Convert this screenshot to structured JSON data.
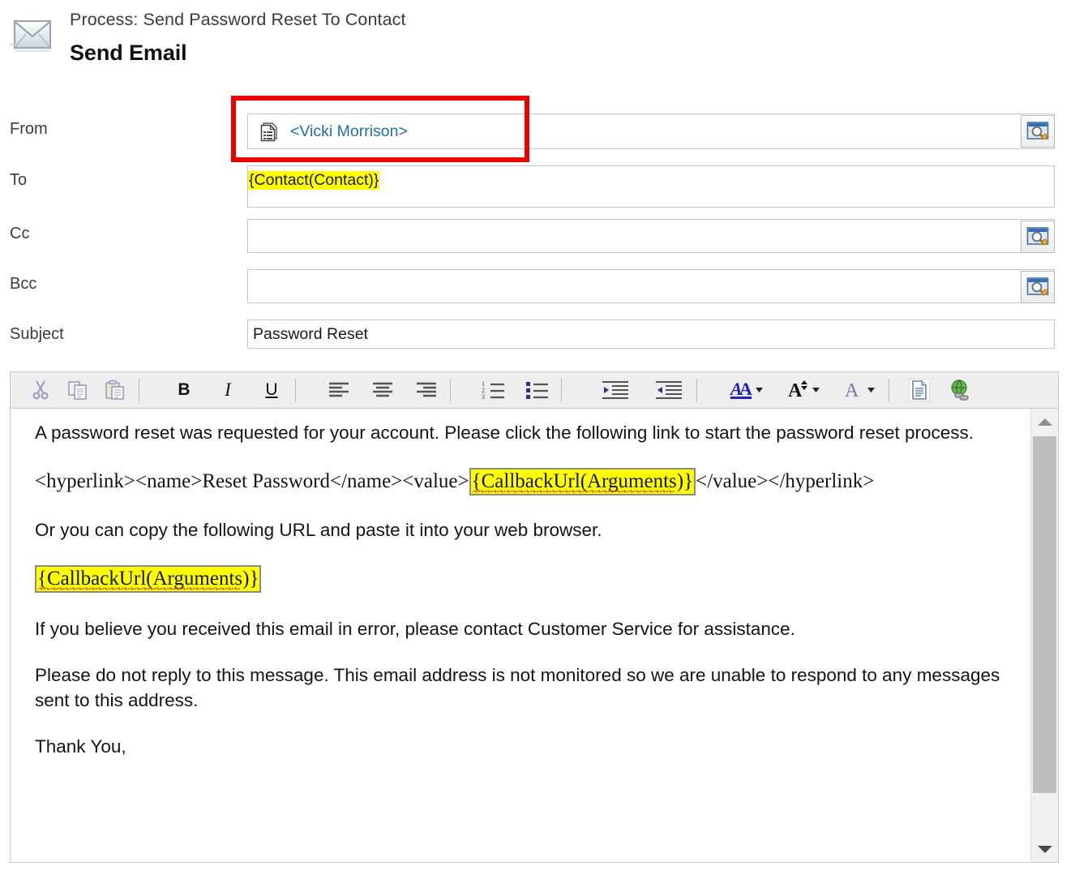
{
  "header": {
    "process_label": "Process: Send Password Reset To Contact",
    "title": "Send Email",
    "icon": "envelope-icon"
  },
  "form": {
    "fields": [
      {
        "label": "From",
        "value": "<Vicki Morrison>",
        "style": "link",
        "icon": "record-lookup-icon",
        "has_lookup_button": true,
        "lookup_icon": "lookup-window-search-icon",
        "highlighted_annotation": true
      },
      {
        "label": "To",
        "value": "{Contact(Contact)}",
        "style": "token-highlight",
        "has_lookup_button": false
      },
      {
        "label": "Cc",
        "value": "",
        "style": "plain",
        "has_lookup_button": true,
        "lookup_icon": "lookup-window-search-icon"
      },
      {
        "label": "Bcc",
        "value": "",
        "style": "plain",
        "has_lookup_button": true,
        "lookup_icon": "lookup-window-search-icon"
      },
      {
        "label": "Subject",
        "value": "Password Reset",
        "style": "plain",
        "has_lookup_button": false
      }
    ]
  },
  "toolbar": {
    "buttons": [
      {
        "name": "cut-icon",
        "label": ""
      },
      {
        "name": "copy-icon",
        "label": ""
      },
      {
        "name": "paste-icon",
        "label": ""
      },
      {
        "name": "bold-button",
        "label": "B"
      },
      {
        "name": "italic-button",
        "label": "I"
      },
      {
        "name": "underline-button",
        "label": "U"
      },
      {
        "name": "align-left-icon",
        "label": ""
      },
      {
        "name": "align-center-icon",
        "label": ""
      },
      {
        "name": "align-right-icon",
        "label": ""
      },
      {
        "name": "numbered-list-icon",
        "label": ""
      },
      {
        "name": "bulleted-list-icon",
        "label": ""
      },
      {
        "name": "increase-indent-icon",
        "label": ""
      },
      {
        "name": "decrease-indent-icon",
        "label": ""
      },
      {
        "name": "font-color-icon",
        "label": ""
      },
      {
        "name": "font-size-icon",
        "label": ""
      },
      {
        "name": "highlight-color-icon",
        "label": ""
      },
      {
        "name": "source-view-icon",
        "label": ""
      },
      {
        "name": "insert-hyperlink-icon",
        "label": ""
      }
    ]
  },
  "body": {
    "paragraphs": [
      {
        "kind": "plain",
        "text": "A password reset was requested for your account. Please click the following link to start the password reset process."
      },
      {
        "kind": "serif-with-token",
        "before": "<hyperlink><name>Reset Password</name><value>",
        "token": "{CallbackUrl(Arguments)}",
        "after": "</value></hyperlink>"
      },
      {
        "kind": "plain",
        "text": "Or you can copy the following URL and paste it into your web browser."
      },
      {
        "kind": "serif-token-only",
        "token": "{CallbackUrl(Arguments)}"
      },
      {
        "kind": "plain",
        "text": "If you believe you received this email in error, please contact Customer Service for assistance."
      },
      {
        "kind": "plain",
        "text": "Please do not reply to this message. This email address is not monitored so we are unable to respond to any messages sent to this address."
      },
      {
        "kind": "plain",
        "text": "Thank You,"
      }
    ],
    "scrollbar": {
      "up_arrow": "scroll-up-arrow-icon",
      "down_arrow": "scroll-down-arrow-icon"
    }
  },
  "colors": {
    "annotation_red": "#ee0000",
    "token_highlight": "#ffff00",
    "link_blue": "#1f6bb8",
    "toolbar_bg": "#eeeeee",
    "border_gray": "#c9c9c9"
  }
}
